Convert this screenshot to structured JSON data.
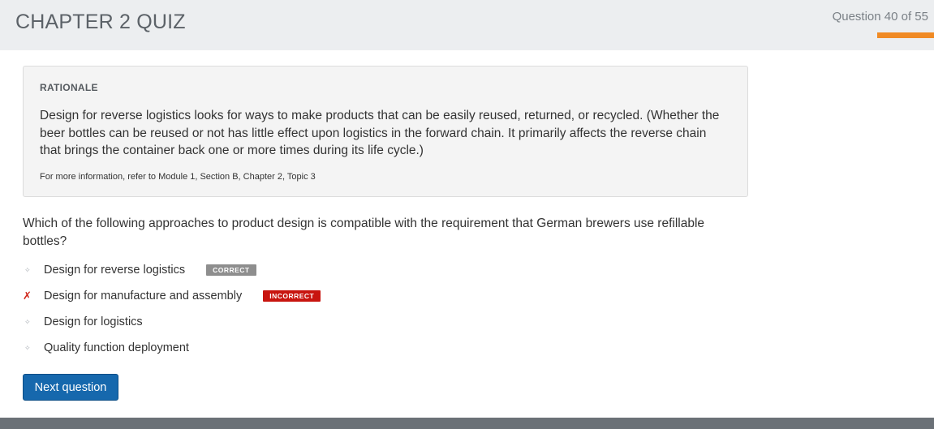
{
  "header": {
    "title": "CHAPTER 2 QUIZ",
    "question_counter": "Question 40 of 55",
    "progress_fraction": 0.727,
    "accent_color": "#f08a24"
  },
  "rationale": {
    "heading": "RATIONALE",
    "body": "Design for reverse logistics looks for ways to make products that can be easily reused, returned, or recycled. (Whether the beer bottles can be reused or not has little effect upon logistics in the forward chain. It primarily affects the reverse chain that brings the container back one or more times during its life cycle.)",
    "reference": "For more information, refer to Module 1, Section B, Chapter 2, Topic 3"
  },
  "question": {
    "text": "Which of the following approaches to product design is compatible with the requirement that German brewers use refillable bottles?"
  },
  "options": [
    {
      "label": "Design for reverse logistics",
      "marker": "✧",
      "badge": "CORRECT",
      "status": "correct"
    },
    {
      "label": "Design for manufacture and assembly",
      "marker": "✗",
      "badge": "INCORRECT",
      "status": "incorrect"
    },
    {
      "label": "Design for logistics",
      "marker": "✧",
      "badge": "",
      "status": "none"
    },
    {
      "label": "Quality function deployment",
      "marker": "✧",
      "badge": "",
      "status": "none"
    }
  ],
  "actions": {
    "next_label": "Next question",
    "next_color": "#1668ad"
  },
  "colors": {
    "correct_badge": "#8e8e8e",
    "incorrect_badge": "#c8150f",
    "footer": "#6b7177"
  }
}
